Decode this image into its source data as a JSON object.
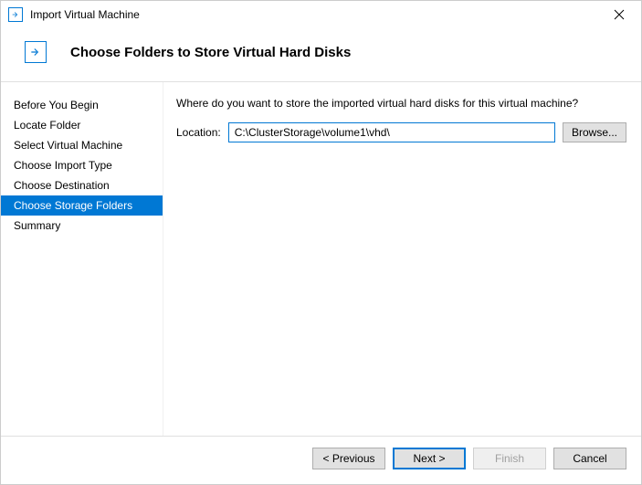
{
  "window": {
    "title": "Import Virtual Machine"
  },
  "header": {
    "title": "Choose Folders to Store Virtual Hard Disks"
  },
  "sidebar": {
    "items": [
      {
        "label": "Before You Begin"
      },
      {
        "label": "Locate Folder"
      },
      {
        "label": "Select Virtual Machine"
      },
      {
        "label": "Choose Import Type"
      },
      {
        "label": "Choose Destination"
      },
      {
        "label": "Choose Storage Folders"
      },
      {
        "label": "Summary"
      }
    ],
    "selected_index": 5
  },
  "content": {
    "prompt": "Where do you want to store the imported virtual hard disks for this virtual machine?",
    "location_label": "Location:",
    "location_value": "C:\\ClusterStorage\\volume1\\vhd\\",
    "browse_label": "Browse..."
  },
  "footer": {
    "previous": "< Previous",
    "next": "Next >",
    "finish": "Finish",
    "cancel": "Cancel"
  }
}
